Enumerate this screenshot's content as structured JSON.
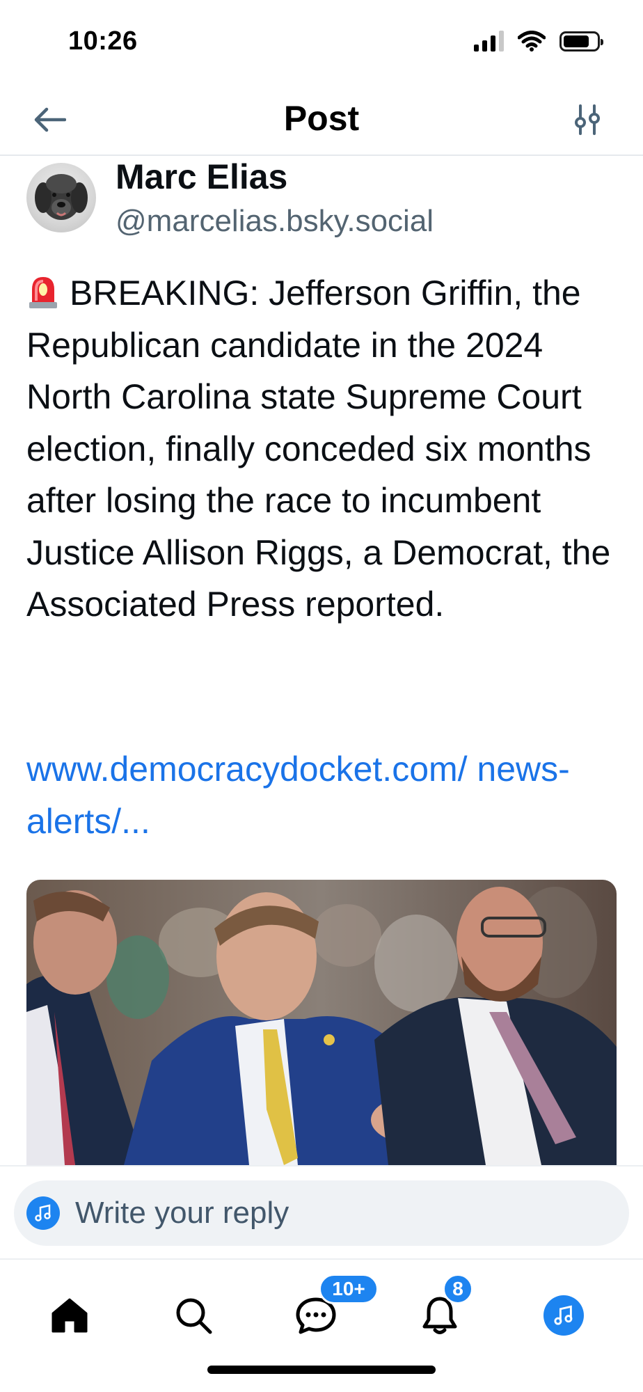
{
  "status_bar": {
    "time": "10:26"
  },
  "header": {
    "title": "Post"
  },
  "author": {
    "name": "Marc Elias",
    "handle": "@marcelias.bsky.social"
  },
  "post": {
    "text": "BREAKING: Jefferson Griffin, the Republican candidate in the 2024 North Carolina state Supreme Court election, finally conceded six months after losing the race to incumbent Justice Allison Riggs, a Democrat, the Associated Press reported.",
    "link_text": "www.democracydocket.com/ news-alerts/..."
  },
  "reply": {
    "placeholder": "Write your reply"
  },
  "nav": {
    "chat_badge": "10+",
    "notifications_badge": "8"
  },
  "colors": {
    "accent": "#1d84f0",
    "link": "#1a73e8",
    "secondary_text": "#536471"
  }
}
